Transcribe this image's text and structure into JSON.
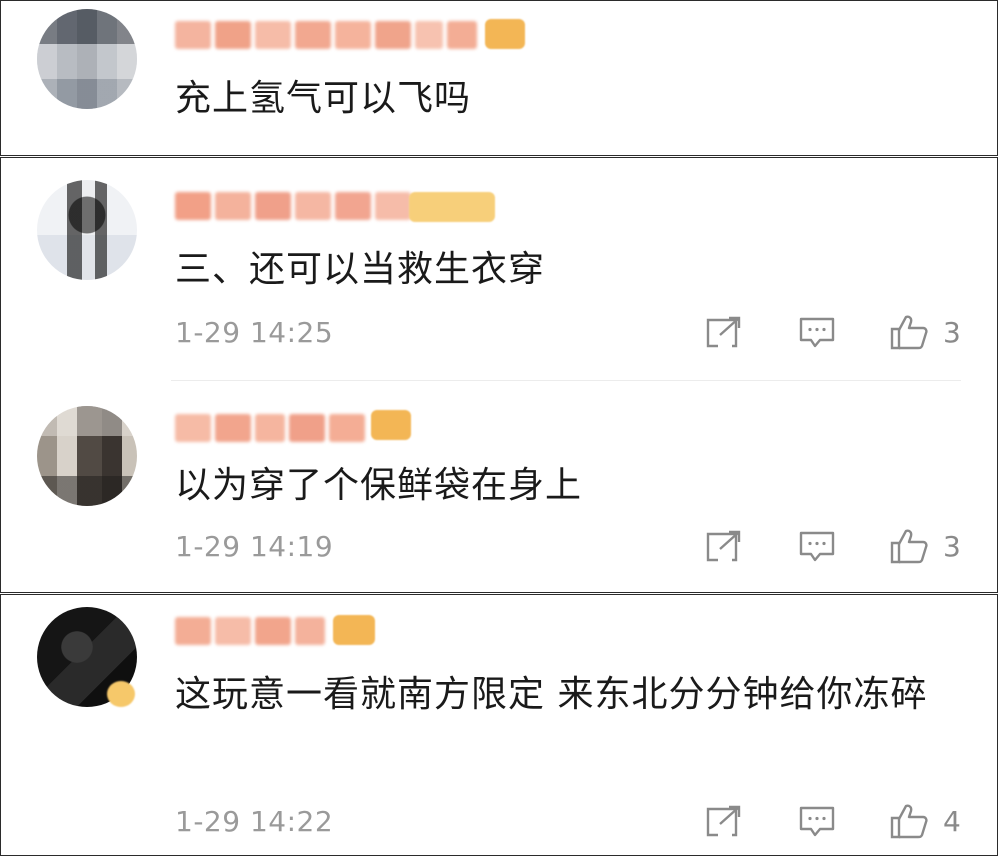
{
  "comments": [
    {
      "username": "",
      "text": "充上氢气可以飞吗"
    },
    {
      "username": "",
      "text": "三、还可以当救生衣穿",
      "time": "1-29 14:25",
      "likes": "3"
    },
    {
      "username": "",
      "text": "以为穿了个保鲜袋在身上",
      "time": "1-29 14:19",
      "likes": "3"
    },
    {
      "username": "",
      "text": "这玩意一看就南方限定 来东北分分钟给你冻碎",
      "time": "1-29 14:22",
      "likes": "4"
    }
  ],
  "colors": {
    "name_blur": "#f2a58c",
    "badge_bg": "#f6c86a",
    "meta_text": "#9a9a9a",
    "icon_stroke": "#8a8a8a"
  },
  "icons": {
    "share": "share-icon",
    "comment": "comment-icon",
    "like": "thumbs-up-icon"
  }
}
